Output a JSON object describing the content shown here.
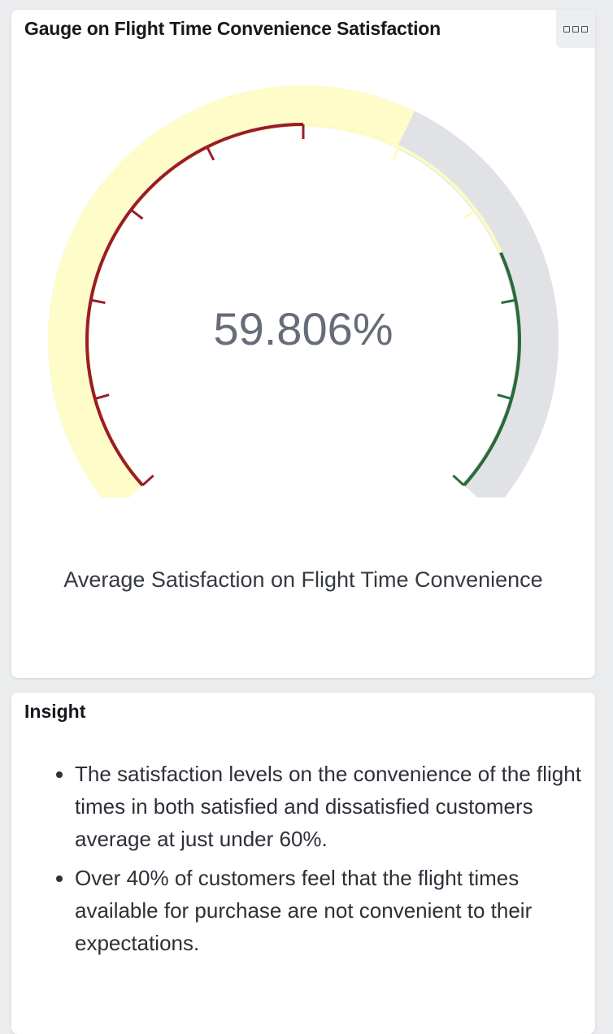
{
  "gauge_panel": {
    "title": "Gauge on Flight Time Convenience Satisfaction",
    "value_label": "59.806%",
    "caption": "Average Satisfaction on Flight Time Convenience"
  },
  "insight_panel": {
    "title": "Insight",
    "bullets": [
      "The satisfaction levels on the convenience of the flight times in both satisfied and dissatisfied customers average at just under 60%.",
      "Over 40% of customers feel that the flight times available for purchase are not convenient to their expectations."
    ]
  },
  "chart_data": {
    "type": "gauge",
    "value": 59.806,
    "min": 0,
    "max": 100,
    "unit": "%",
    "bands": [
      {
        "from": 0,
        "to": 50,
        "color": "#9b1b2a"
      },
      {
        "from": 50,
        "to": 75,
        "color": "#fdfbc4"
      },
      {
        "from": 75,
        "to": 100,
        "color": "#2a6a3a"
      }
    ],
    "colors": {
      "fill": "#fefcc8",
      "track": "#e1e2e5"
    }
  }
}
